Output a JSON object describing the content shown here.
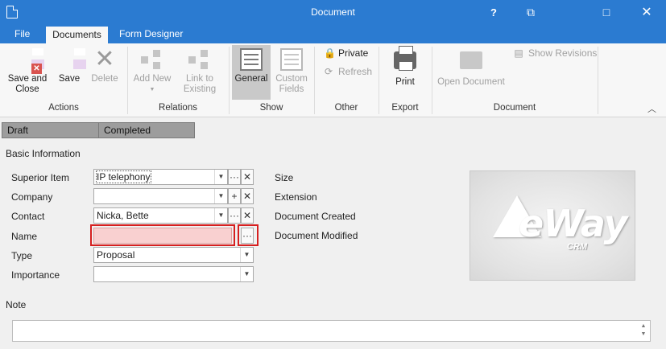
{
  "window": {
    "title": "Document",
    "help_label": "?",
    "restore_label": "⧉",
    "minimize_label": "□",
    "close_label": "✕"
  },
  "tabs": [
    {
      "label": "File"
    },
    {
      "label": "Documents"
    },
    {
      "label": "Form Designer"
    }
  ],
  "ribbon": {
    "actions": {
      "save_close": "Save and Close",
      "save": "Save",
      "delete": "Delete",
      "group": "Actions"
    },
    "relations": {
      "add_new": "Add New",
      "link_existing": "Link to Existing",
      "group": "Relations"
    },
    "show": {
      "general": "General",
      "custom_fields": "Custom Fields",
      "group": "Show"
    },
    "other": {
      "private": "Private",
      "refresh": "Refresh",
      "group": "Other"
    },
    "export": {
      "print": "Print",
      "group": "Export"
    },
    "document": {
      "open_document": "Open Document",
      "show_revisions": "Show Revisions",
      "group": "Document"
    },
    "collapse_label": "︿"
  },
  "status": {
    "draft": "Draft",
    "completed": "Completed"
  },
  "basic_info": {
    "title": "Basic Information",
    "labels": {
      "superior_item": "Superior Item",
      "company": "Company",
      "contact": "Contact",
      "name": "Name",
      "type": "Type",
      "importance": "Importance"
    },
    "values": {
      "superior_item": "IP telephony",
      "company": "",
      "contact": "Nicka, Bette",
      "name": "",
      "type": "Proposal",
      "importance": ""
    },
    "right_labels": {
      "size": "Size",
      "extension": "Extension",
      "created": "Document Created",
      "modified": "Document Modified"
    }
  },
  "logo": {
    "text": "eWay",
    "sub": "CRM"
  },
  "note": {
    "label": "Note",
    "value": ""
  },
  "colors": {
    "titlebar": "#2b7bd1",
    "invalid_field": "#f9d0d0",
    "highlight": "#d62020"
  }
}
